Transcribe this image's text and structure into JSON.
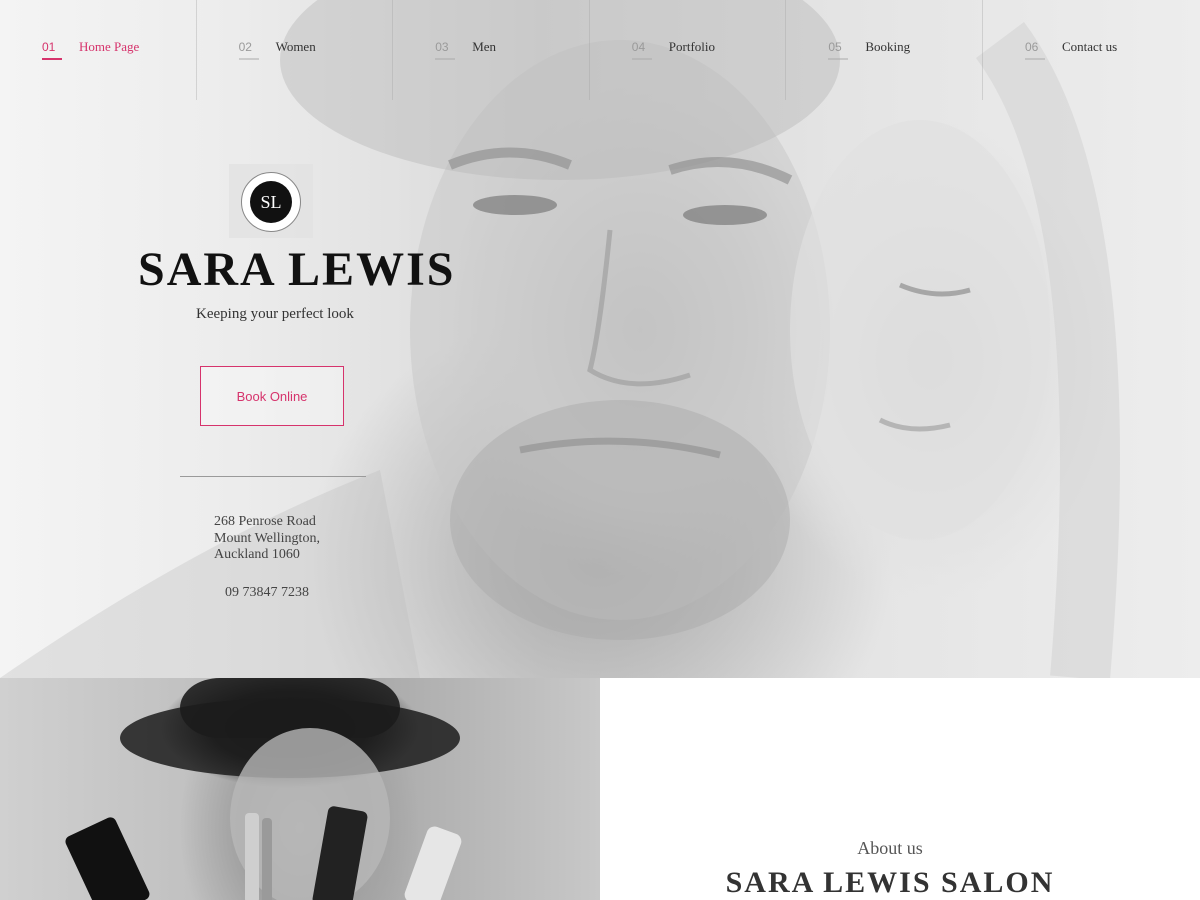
{
  "nav": {
    "items": [
      {
        "num": "01",
        "label": "Home Page"
      },
      {
        "num": "02",
        "label": "Women"
      },
      {
        "num": "03",
        "label": "Men"
      },
      {
        "num": "04",
        "label": "Portfolio"
      },
      {
        "num": "05",
        "label": "Booking"
      },
      {
        "num": "06",
        "label": "Contact us"
      }
    ],
    "active_index": 0
  },
  "hero": {
    "logo_text": "SL",
    "title": "SARA LEWIS",
    "tagline": "Keeping your perfect look",
    "cta_label": "Book Online",
    "address_lines": [
      "268 Penrose Road",
      "Mount Wellington,",
      "Auckland 1060"
    ],
    "phone": "09 73847 7238"
  },
  "about": {
    "label": "About us",
    "title": "SARA LEWIS SALON"
  },
  "colors": {
    "accent": "#d6336c",
    "text": "#333333",
    "background": "#ffffff"
  }
}
